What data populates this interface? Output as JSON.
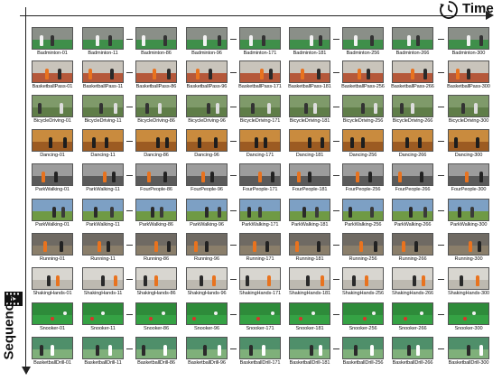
{
  "axes": {
    "time_label": "Time",
    "sequence_label": "Sequence"
  },
  "icons": {
    "time": "clock-icon",
    "sequence": "film-strip-icon"
  },
  "columns": [
    {
      "frame": "01"
    },
    {
      "frame": "11"
    },
    {
      "frame": "86"
    },
    {
      "frame": "96"
    },
    {
      "frame": "171"
    },
    {
      "frame": "181"
    },
    {
      "frame": "256"
    },
    {
      "frame": "266"
    },
    {
      "frame": "300"
    }
  ],
  "rows": [
    {
      "theme": "gym-green",
      "labels": [
        "Badminton-01",
        "Badminton-11",
        "Badminton-86",
        "Badminton-96",
        "Badminton-171",
        "Badminton-181",
        "Badminton-256",
        "Badminton-266",
        "Badminton-300"
      ]
    },
    {
      "theme": "court-red",
      "labels": [
        "BasketballPass-01",
        "BasketballPass-11",
        "BasketballPass-86",
        "BasketballPass-96",
        "BasketballPass-171",
        "BasketballPass-181",
        "BasketballPass-256",
        "BasketballPass-266",
        "BasketballPass-300"
      ]
    },
    {
      "theme": "outdoor-green",
      "labels": [
        "BicycleDriving-01",
        "BicycleDriving-11",
        "BicycleDriving-86",
        "BicycleDriving-96",
        "BicycleDriving-171",
        "BicycleDriving-181",
        "BicycleDriving-256",
        "BicycleDriving-266",
        "BicycleDriving-300"
      ]
    },
    {
      "theme": "wood-orange",
      "labels": [
        "Dancing-01",
        "Dancing-11",
        "Dancing-86",
        "Dancing-96",
        "Dancing-171",
        "Dancing-181",
        "Dancing-256",
        "Dancing-266",
        "Dancing-300"
      ]
    },
    {
      "theme": "indoor-gray",
      "labels": [
        "ParkWalking-01",
        "ParkWalking-11",
        "FourPeople-86",
        "FourPeople-96",
        "FourPeople-171",
        "FourPeople-181",
        "FourPeople-256",
        "FourPeople-266",
        "FourPeople-300"
      ]
    },
    {
      "theme": "park",
      "labels": [
        "ParkWalking-01",
        "ParkWalking-11",
        "ParkWalking-86",
        "ParkWalking-96",
        "ParkWalking-171",
        "ParkWalking-181",
        "ParkWalking-256",
        "ParkWalking-266",
        "ParkWalking-300"
      ]
    },
    {
      "theme": "gym-dark",
      "labels": [
        "Running-01",
        "Running-11",
        "Running-86",
        "Running-96",
        "Running-171",
        "Running-181",
        "Running-256",
        "Running-266",
        "Running-300"
      ]
    },
    {
      "theme": "wall-light",
      "labels": [
        "ShakingHands-01",
        "ShakingHands-11",
        "ShakingHands-86",
        "ShakingHands-96",
        "ShakingHands-171",
        "ShakingHands-181",
        "ShakingHands-256",
        "ShakingHands-266",
        "ShakingHands-300"
      ]
    },
    {
      "theme": "snooker",
      "labels": [
        "Snooker-01",
        "Snooker-11",
        "Snooker-86",
        "Snooker-96",
        "Snooker-171",
        "Snooker-181",
        "Snooker-256",
        "Snooker-266",
        "Snooker-300"
      ]
    },
    {
      "theme": "court-green",
      "labels": [
        "BasketballDrill-01",
        "BasketballDrill-11",
        "BasketballDrill-86",
        "BasketballDrill-96",
        "BasketballDrill-171",
        "BasketballDrill-181",
        "BasketballDrill-256",
        "BasketballDrill-266",
        "BasketballDrill-300"
      ]
    }
  ],
  "themes": {
    "gym-green": {
      "bg": "#8a8f88",
      "floor": "#3f8f4a",
      "fig": [
        "#f2f2f2",
        "#333333"
      ]
    },
    "court-red": {
      "bg": "#c9c4bb",
      "floor": "#b5583a",
      "fig": [
        "#e8731f",
        "#2a2a2a"
      ]
    },
    "outdoor-green": {
      "bg": "#7f9a6a",
      "floor": "#5f7d48",
      "fig": [
        "#333333",
        "#dddddd"
      ]
    },
    "wood-orange": {
      "bg": "#c98b3e",
      "floor": "#9c5b22",
      "fig": [
        "#1e1e1e",
        "#1e1e1e"
      ]
    },
    "indoor-gray": {
      "bg": "#9c9c9c",
      "floor": "#5a5a5a",
      "fig": [
        "#e8731f",
        "#222222"
      ]
    },
    "park": {
      "bg": "#7da0c4",
      "floor": "#6f9a45",
      "fig": [
        "#2a2a2a",
        "#3a3a3a"
      ]
    },
    "gym-dark": {
      "bg": "#6f6a63",
      "floor": "#8a7e6a",
      "fig": [
        "#e8731f",
        "#222222"
      ]
    },
    "wall-light": {
      "bg": "#d8d6d0",
      "floor": "#bdb9b0",
      "fig": [
        "#2a2a2a",
        "#e8731f"
      ]
    },
    "snooker": {
      "bg": "#2e8b3a",
      "floor": "#35a244",
      "fig": [
        "#d9332b",
        "#f2f2f2"
      ]
    },
    "court-green": {
      "bg": "#4f8f6a",
      "floor": "#7fb07a",
      "fig": [
        "#2a2a2a",
        "#ffffff"
      ]
    }
  }
}
